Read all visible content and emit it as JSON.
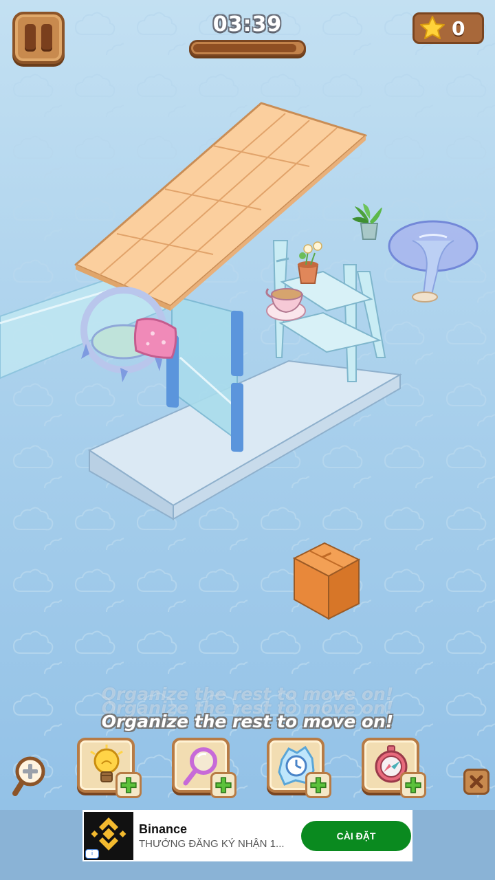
{
  "hud": {
    "timer": "03:39",
    "timer_progress": 0.95,
    "stars": "0"
  },
  "message": "Organize the rest to move on!",
  "boosters": [
    {
      "name": "hint",
      "icon": "lightbulb-icon"
    },
    {
      "name": "magnifier",
      "icon": "magnifying-glass-icon"
    },
    {
      "name": "freeze-time",
      "icon": "frozen-clock-icon"
    },
    {
      "name": "compass",
      "icon": "compass-icon"
    }
  ],
  "ad": {
    "title": "Binance",
    "subtitle": "THƯỞNG ĐĂNG KÝ NHẬN 1...",
    "cta": "CÀI ĐẶT",
    "info": "i"
  },
  "colors": {
    "wood": "#c88a4e",
    "wood_dark": "#7a4520",
    "background": "#a9d0ec",
    "ad_cta": "#0a8a1f",
    "binance_yellow": "#f3ba2f"
  }
}
